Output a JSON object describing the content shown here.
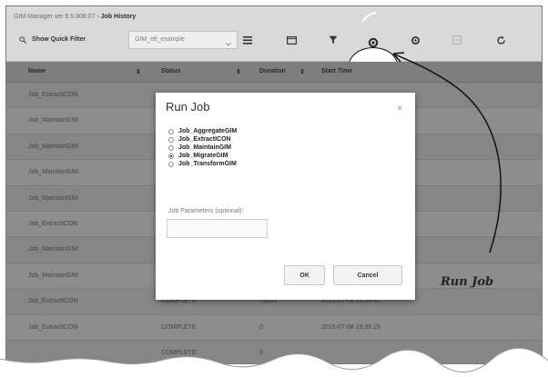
{
  "breadcrumb": {
    "app": "GIM Manager ver 6.5.808.07",
    "separator": "›",
    "current": "Job History"
  },
  "toolbar": {
    "quick_filter_label": "Show Quick Filter",
    "filter_value": "GIM_etl_example",
    "icons": [
      "list-icon",
      "folder-icon",
      "filter-icon",
      "run-job-gear-icon",
      "gear-icon",
      "export-icon",
      "refresh-icon"
    ]
  },
  "grid": {
    "columns": [
      "Name",
      "Status",
      "Duration",
      "Start Time"
    ],
    "sort_glyph": "⇕",
    "rows": [
      {
        "name": "Job_ExtractICON",
        "status": "",
        "duration": "",
        "start": ""
      },
      {
        "name": "Job_MaintainGIM",
        "status": "",
        "duration": "",
        "start": ""
      },
      {
        "name": "Job_MaintainGIM",
        "status": "",
        "duration": "",
        "start": ""
      },
      {
        "name": "Job_MaintainGIM",
        "status": "",
        "duration": "",
        "start": ""
      },
      {
        "name": "Job_MaintainGIM",
        "status": "",
        "duration": "",
        "start": ""
      },
      {
        "name": "Job_ExtractICON",
        "status": "",
        "duration": "",
        "start": ""
      },
      {
        "name": "Job_MaintainGIM",
        "status": "",
        "duration": "",
        "start": ""
      },
      {
        "name": "Job_MaintainGIM",
        "status": "",
        "duration": "",
        "start": ""
      },
      {
        "name": "Job_ExtractICON",
        "status": "COMPLETE",
        "duration": "79553",
        "start": "2015-07-08 19:39:41"
      },
      {
        "name": "Job_ExtractICON",
        "status": "COMPLETE",
        "duration": "0",
        "start": "2015-07-08 19:36:25"
      },
      {
        "name": "",
        "status": "COMPLETE",
        "duration": "3",
        "start": ""
      }
    ]
  },
  "modal": {
    "title": "Run Job",
    "close": "×",
    "options": [
      {
        "label": "Job_AggregateGIM",
        "selected": false
      },
      {
        "label": "Job_ExtractICON",
        "selected": false
      },
      {
        "label": "Job_MaintainGIM",
        "selected": false
      },
      {
        "label": "Job_MigrateGIM",
        "selected": true
      },
      {
        "label": "Job_TransformGIM",
        "selected": false
      }
    ],
    "params_label": "Job Parameters (optional):",
    "params_value": "",
    "ok_label": "OK",
    "cancel_label": "Cancel"
  },
  "annotation": {
    "label": "Run Job"
  },
  "colors": {
    "overlay": "#8a8a8a",
    "modal_bg": "#ffffff",
    "annotation": "#111111"
  }
}
